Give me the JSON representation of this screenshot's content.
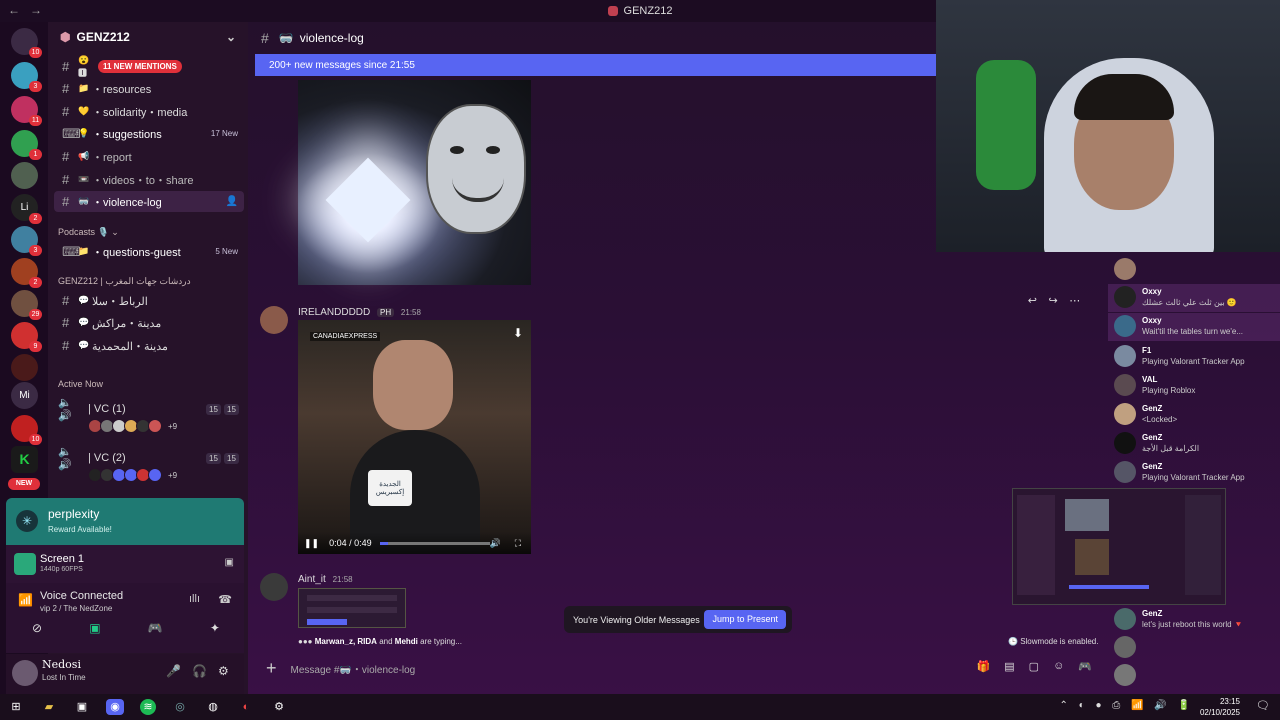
{
  "window": {
    "title": "GENZ212",
    "back": "←",
    "forward": "→"
  },
  "rail": {
    "badges": [
      "10",
      "3",
      "11",
      "1",
      "2",
      "3",
      "2",
      "29",
      "9",
      "10",
      "NEW"
    ],
    "letters": [
      "Li",
      "Mi",
      "K"
    ]
  },
  "server": {
    "name": "GENZ212",
    "chevron": "⌄"
  },
  "channels": [
    {
      "name": "11 NEW MENTIONS",
      "type": "mention"
    },
    {
      "name": "・resources",
      "icon": "📁"
    },
    {
      "name": "・solidarity・media",
      "icon": "💛"
    },
    {
      "name": "・suggestions",
      "icon": "💡",
      "new": "17 New"
    },
    {
      "name": "・report",
      "icon": "📢"
    },
    {
      "name": "・videos・to・share",
      "icon": "📼"
    },
    {
      "name": "・violence-log",
      "icon": "🥽",
      "active": true
    }
  ],
  "podcasts": {
    "category": "Podcasts 🎙️ ⌄",
    "channel": "・questions-guest",
    "new": "5 New"
  },
  "arabic_category": "GENZ212 | دردشات جهات المغرب",
  "arabic_channels": [
    "الرباط・سلا",
    "مدينة・مراكش",
    "مدينة・المحمدية"
  ],
  "active_now": {
    "label": "Active Now",
    "vcs": [
      {
        "name": "| VC (1)",
        "count1": "15",
        "count2": "15",
        "more": "+9"
      },
      {
        "name": "| VC (2)",
        "count1": "15",
        "count2": "15",
        "more": "+9"
      }
    ]
  },
  "promo": {
    "title": "perplexity",
    "subtitle": "Reward Available!"
  },
  "screen_share": {
    "title": "Screen 1",
    "subtitle": "1440p 60FPS"
  },
  "voice": {
    "status": "Voice Connected",
    "channel": "vip 2 / The NedZone"
  },
  "user": {
    "name": "Nedosi",
    "status": "Lost In Time"
  },
  "channel_header": {
    "name": "violence-log"
  },
  "new_messages_bar": "200+ new messages since 21:55",
  "messages": [
    {
      "author": "IRELANDDDDD",
      "tag": "PH",
      "time": "21:58",
      "video_time": "0:04 / 0:49",
      "progress": 0.08,
      "video_label": "CANADIAEXPRESS",
      "mic_label": "الجديدة إكسبريس"
    },
    {
      "author": "Aint_it",
      "time": "21:58"
    }
  ],
  "typing": {
    "names": "Marwan_z, RIDA",
    "and": "and",
    "last": "Mehdi",
    "suffix": "are typing..."
  },
  "slowmode": "Slowmode is enabled.",
  "older_banner": {
    "text": "You're Viewing Older Messages",
    "button": "Jump to Present"
  },
  "composer": {
    "placeholder": "Message #🥽・violence-log"
  },
  "members": [
    {
      "name": "Oxxy",
      "status": "بين ثلث علي ثالث عشلك 🙂"
    },
    {
      "name": "Oxxy",
      "status": "Wait'til the tables turn we'e..."
    },
    {
      "name": "F1",
      "status": "Playing Valorant Tracker App"
    },
    {
      "name": "VAL",
      "status": "Playing Roblox"
    },
    {
      "name": "GenZ",
      "status": "<Locked>"
    },
    {
      "name": "GenZ",
      "status": "الكرامة قبل الأجة"
    },
    {
      "name": "GenZ",
      "status": "Playing Valorant Tracker App"
    },
    {
      "name": "GenZ",
      "status": "let's just reboot this world 🔻"
    }
  ],
  "taskbar": {
    "time": "23:15",
    "date": "02/10/2025"
  },
  "colors": {
    "accent": "#5865f2",
    "mention": "#e0303a",
    "promo": "#1f7a73"
  }
}
